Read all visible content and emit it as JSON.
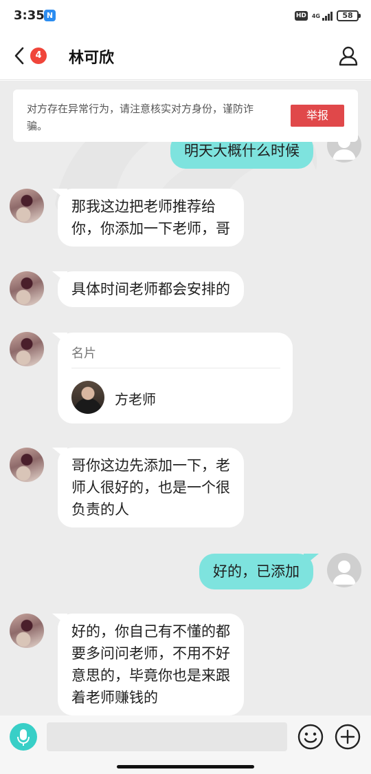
{
  "status_bar": {
    "time": "3:35",
    "app_icon_letter": "N",
    "hd_label": "HD",
    "network_label": "4G",
    "battery_level": "58"
  },
  "header": {
    "unread_count": "4",
    "title": "林可欣"
  },
  "warning": {
    "text": "对方存在异常行为，请注意核实对方身份，谨防诈骗。",
    "report_label": "举报"
  },
  "messages": [
    {
      "direction": "out",
      "text": "明天大概什么时候"
    },
    {
      "direction": "in",
      "line1": "那我这边把老师推荐给",
      "line2": "你，你添加一下老师，哥"
    },
    {
      "direction": "in",
      "text": "具体时间老师都会安排的"
    },
    {
      "direction": "in",
      "type": "card",
      "card_label": "名片",
      "card_name": "方老师"
    },
    {
      "direction": "in",
      "line1": "哥你这边先添加一下，老",
      "line2": "师人很好的，也是一个很",
      "line3": "负责的人"
    },
    {
      "direction": "out",
      "text": "好的，已添加"
    },
    {
      "direction": "in",
      "line1": "好的，你自己有不懂的都",
      "line2": "要多问问老师，不用不好",
      "line3": "意思的，毕竟你也是来跟",
      "line4": "着老师赚钱的"
    }
  ],
  "colors": {
    "outgoing_bubble": "#7ee3de",
    "incoming_bubble": "#ffffff",
    "report_button": "#e0484a",
    "badge": "#f0453a",
    "chat_background": "#ececec",
    "voice_button": "#38cfc7"
  },
  "icons": {
    "back": "chevron-left-icon",
    "profile": "person-icon",
    "voice": "microphone-icon",
    "emoji": "smiley-icon",
    "more": "plus-circle-icon"
  }
}
